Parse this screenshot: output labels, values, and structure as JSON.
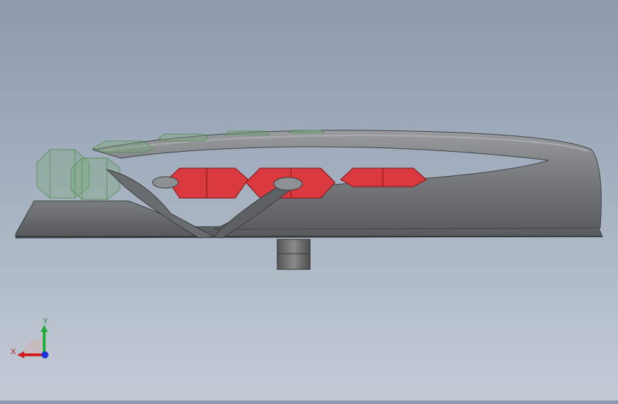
{
  "viewport": {
    "background_top": "#8c9aab",
    "background_bottom": "#c3cbd5",
    "model": {
      "base_color": "#6f7275",
      "rim_color": "#85888b",
      "hinge_color": "#5a5d60",
      "red_gem_color": "#d9393f",
      "red_gem_dark": "#a82227",
      "green_wire_color": "#6f9a6f"
    }
  },
  "triad": {
    "x_label": "X",
    "y_label": "Y",
    "x_color": "#d21f1f",
    "y_color": "#1fae3a",
    "z_color": "#1c33d6"
  }
}
